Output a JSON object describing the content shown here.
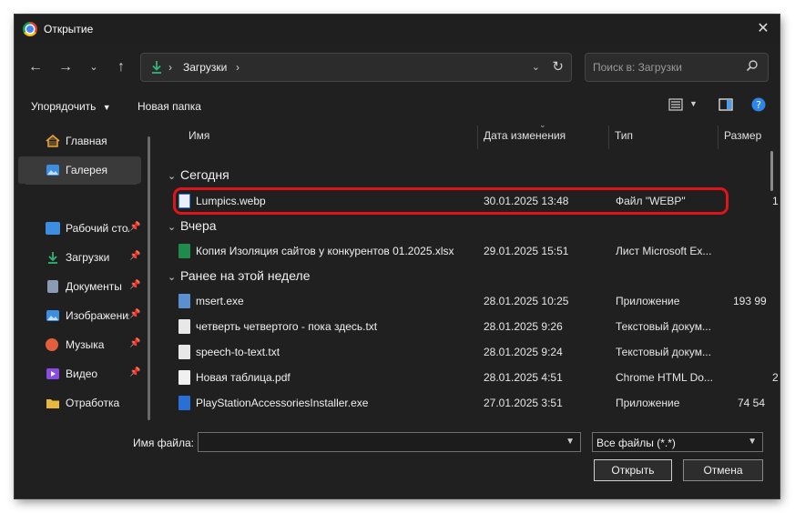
{
  "window": {
    "title": "Открытие"
  },
  "nav": {
    "breadcrumb": "Загрузки",
    "search_placeholder": "Поиск в: Загрузки"
  },
  "toolbar": {
    "organize": "Упорядочить",
    "new_folder": "Новая папка"
  },
  "sidebar": {
    "items": [
      {
        "label": "Главная",
        "icon": "home-icon",
        "color": "#e8a03a"
      },
      {
        "label": "Галерея",
        "icon": "gallery-icon",
        "color": "#3d8ee0"
      },
      {
        "label": "Рабочий стол",
        "icon": "desktop-icon",
        "color": "#3d8ee0"
      },
      {
        "label": "Загрузки",
        "icon": "download-icon",
        "color": "#2fb67a"
      },
      {
        "label": "Документы",
        "icon": "documents-icon",
        "color": "#8a9bb3"
      },
      {
        "label": "Изображения",
        "icon": "pictures-icon",
        "color": "#3d8ee0"
      },
      {
        "label": "Музыка",
        "icon": "music-icon",
        "color": "#e0603d"
      },
      {
        "label": "Видео",
        "icon": "video-icon",
        "color": "#8a4be0"
      },
      {
        "label": "Отработка",
        "icon": "folder-icon",
        "color": "#e8b83a"
      }
    ]
  },
  "columns": {
    "name": "Имя",
    "date": "Дата изменения",
    "type": "Тип",
    "size": "Размер"
  },
  "groups": {
    "today": "Сегодня",
    "yesterday": "Вчера",
    "this_week": "Ранее на этой неделе"
  },
  "files": [
    {
      "name": "Lumpics.webp",
      "date": "30.01.2025 13:48",
      "type": "Файл \"WEBP\"",
      "size": "1",
      "icon": "webp-file-icon",
      "color": "#3d7de0"
    },
    {
      "name": "Копия Изоляция сайтов у конкурентов 01.2025.xlsx",
      "date": "29.01.2025 15:51",
      "type": "Лист Microsoft Ex...",
      "size": "",
      "icon": "excel-file-icon",
      "color": "#1f8a4c"
    },
    {
      "name": "msert.exe",
      "date": "28.01.2025 10:25",
      "type": "Приложение",
      "size": "193 99",
      "icon": "exe-file-icon",
      "color": "#5a8fd0"
    },
    {
      "name": "четверть четвертого - пока здесь.txt",
      "date": "28.01.2025 9:26",
      "type": "Текстовый докум...",
      "size": "",
      "icon": "txt-file-icon",
      "color": "#e8e8e8"
    },
    {
      "name": "speech-to-text.txt",
      "date": "28.01.2025 9:24",
      "type": "Текстовый докум...",
      "size": "",
      "icon": "txt-file-icon",
      "color": "#e8e8e8"
    },
    {
      "name": "Новая таблица.pdf",
      "date": "28.01.2025 4:51",
      "type": "Chrome HTML Do...",
      "size": "2",
      "icon": "pdf-file-icon",
      "color": "#f0f0f0"
    },
    {
      "name": "PlayStationAccessoriesInstaller.exe",
      "date": "27.01.2025 3:51",
      "type": "Приложение",
      "size": "74 54",
      "icon": "installer-file-icon",
      "color": "#2a6fd6"
    }
  ],
  "bottom": {
    "filename_label": "Имя файла:",
    "filename_value": "",
    "filter": "Все файлы (*.*)",
    "open": "Открыть",
    "cancel": "Отмена"
  },
  "colors": {
    "highlight": "#e0151b",
    "window_bg": "#202020"
  }
}
